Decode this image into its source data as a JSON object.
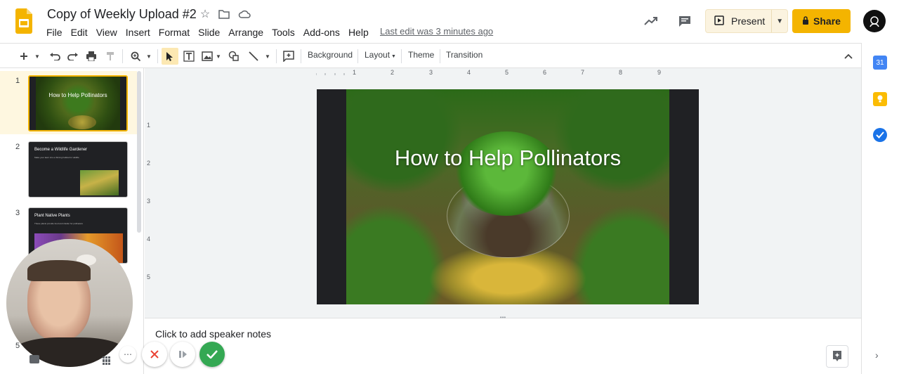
{
  "doc": {
    "title": "Copy of Weekly Upload #2",
    "last_edit": "Last edit was 3 minutes ago"
  },
  "menu": [
    "File",
    "Edit",
    "View",
    "Insert",
    "Format",
    "Slide",
    "Arrange",
    "Tools",
    "Add-ons",
    "Help"
  ],
  "header": {
    "present_label": "Present",
    "share_label": "Share"
  },
  "toolbar": {
    "background": "Background",
    "layout": "Layout",
    "theme": "Theme",
    "transition": "Transition"
  },
  "ruler": {
    "h": [
      "1",
      "2",
      "3",
      "4",
      "5",
      "6",
      "7",
      "8",
      "9"
    ],
    "v": [
      "1",
      "2",
      "3",
      "4",
      "5"
    ]
  },
  "slides": [
    {
      "number": "1",
      "title": "How to Help Pollinators"
    },
    {
      "number": "2",
      "title": "Become a Wildlife Gardener",
      "body": "Make your lawn into a thriving habitat for wildlife"
    },
    {
      "number": "3",
      "title": "Plant Native Plants",
      "body": "These plants provide food and shelter for pollinators"
    },
    {
      "number": "5"
    }
  ],
  "current_slide": {
    "title": "How to Help Pollinators"
  },
  "notes": {
    "placeholder": "Click to add speaker notes"
  },
  "colors": {
    "accent": "#f4b400",
    "present_bg": "#fbf3e0",
    "record_green": "#34a853",
    "record_red": "#ea4335"
  }
}
